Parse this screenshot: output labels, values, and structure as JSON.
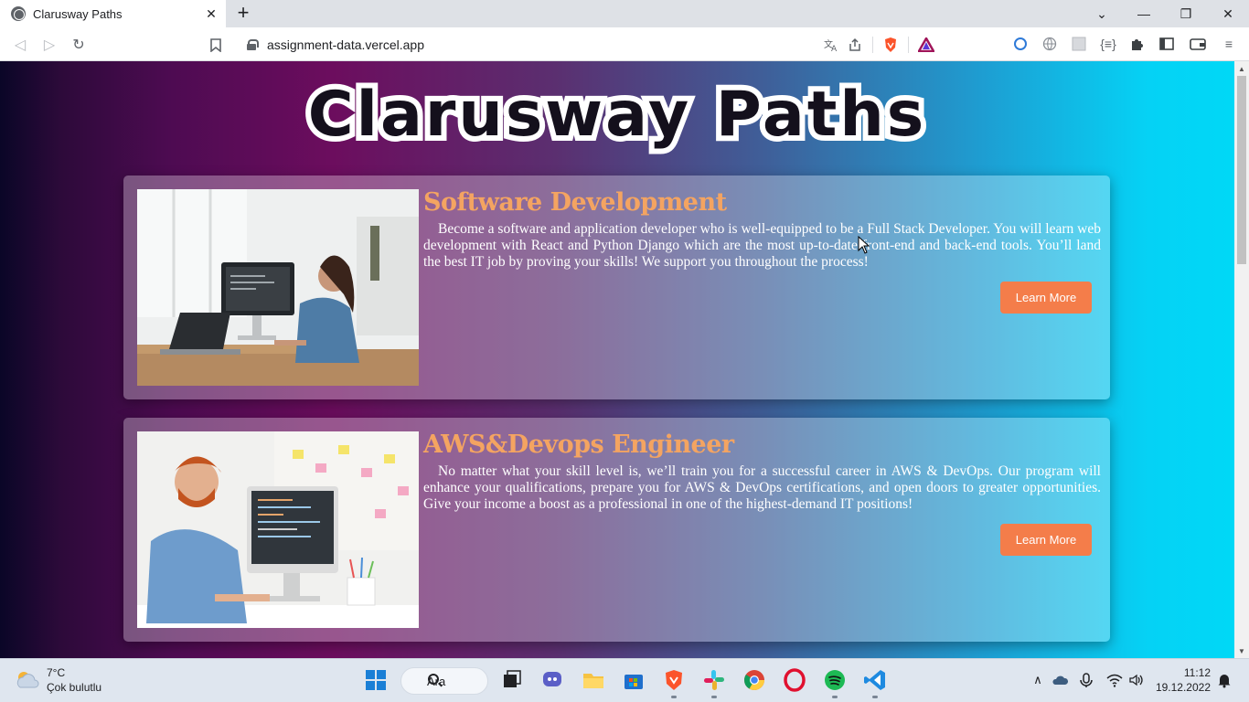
{
  "browser": {
    "tab_title": "Clarusway Paths",
    "url": "assignment-data.vercel.app",
    "new_tab_label": "+",
    "close_label": "✕"
  },
  "page": {
    "site_title": "Clarusway Paths",
    "cards": [
      {
        "title": "Software Development",
        "text": "Become a software and application developer who is well-equipped to be a Full Stack Developer. You will learn web development with React and Python Django which are the most up-to-date front-end and back-end tools. You’ll land the best IT job by proving your skills! We support you throughout the process!",
        "button": "Learn More"
      },
      {
        "title": "AWS&Devops Engineer",
        "text": "No matter what your skill level is, we’ll train you for a successful career in AWS & DevOps. Our program will enhance your qualifications, prepare you for AWS & DevOps certifications, and open doors to greater opportunities. Give your income a boost as a professional in one of the highest-demand IT positions!",
        "button": "Learn More"
      }
    ]
  },
  "taskbar": {
    "weather_temp": "7°C",
    "weather_desc": "Çok bulutlu",
    "search_label": "Ara",
    "time": "11:12",
    "date": "19.12.2022"
  },
  "colors": {
    "card_title": "#f4a461",
    "button_bg": "#f47d4a",
    "gradient_left": "#0a0627",
    "gradient_mid": "#6c0d5e",
    "gradient_right": "#00d8f6"
  }
}
